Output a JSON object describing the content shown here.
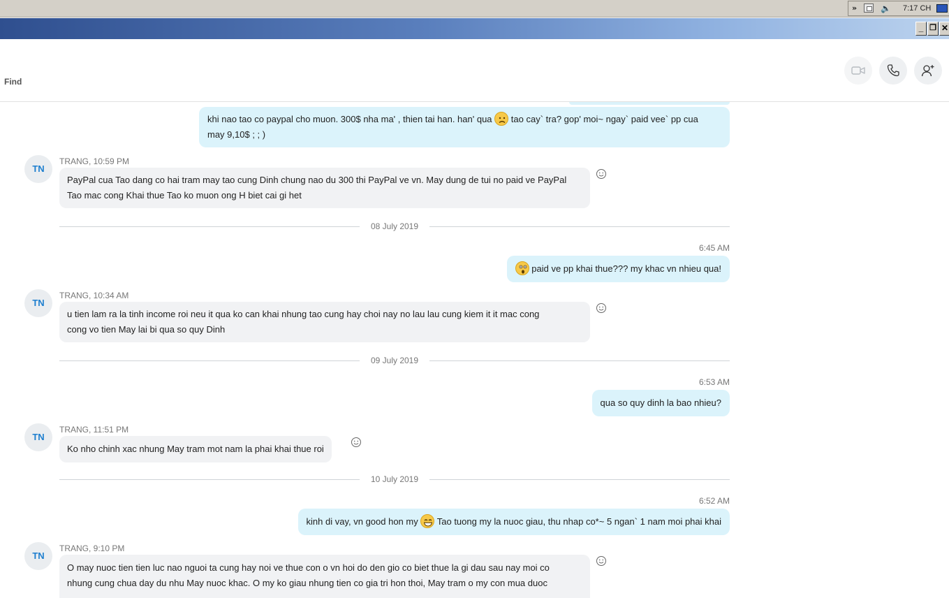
{
  "taskbar": {
    "chevron": "»",
    "clock": "7:17 CH"
  },
  "window": {
    "minimize": "_",
    "maximize": "❐",
    "close": "✕"
  },
  "header": {
    "find_label": "Find"
  },
  "separators": [
    "08 July 2019",
    "09 July 2019",
    "10 July 2019"
  ],
  "messages": {
    "m1": {
      "lines": [
        "khi nao tao co paypal cho muon. 300$ nha ma' , thien tai han. han' qua",
        "tao cay` tra? gop' moi~ ngay` paid vee` pp cua",
        "may 9,10$ ; ; )"
      ]
    },
    "m2": {
      "sender": "TRANG, 10:59 PM",
      "avatar": "TN",
      "lines": [
        "PayPal cua Tao dang co hai tram may tao cung Dinh chung nao du 300 thi PayPal ve vn. May dung de tui no paid ve PayPal",
        "Tao mac cong Khai thue Tao ko muon ong H biet cai gi het"
      ]
    },
    "m3": {
      "time": "6:45 AM",
      "text": "paid ve pp khai thue??? my khac vn nhieu qua!"
    },
    "m4": {
      "sender": "TRANG, 10:34 AM",
      "avatar": "TN",
      "lines": [
        "u tien lam ra la tinh income roi neu it qua ko can khai nhung tao cung hay choi nay no lau lau cung kiem it it mac cong",
        "cong vo tien May lai bi qua so quy Dinh"
      ]
    },
    "m5": {
      "time": "6:53 AM",
      "text": "qua so quy dinh la bao nhieu?"
    },
    "m6": {
      "sender": "TRANG, 11:51 PM",
      "avatar": "TN",
      "text": "Ko nho chinh xac nhung May tram mot nam la phai khai thue roi"
    },
    "m7": {
      "time": "6:52 AM",
      "text_a": "kinh di vay, vn good hon my",
      "text_b": "Tao tuong my la nuoc giau, thu nhap co*~ 5 ngan` 1 nam moi phai khai"
    },
    "m8": {
      "sender": "TRANG, 9:10 PM",
      "avatar": "TN",
      "lines": [
        "O may nuoc tien tien luc nao nguoi ta cung hay noi ve thue con o vn hoi do den gio co biet thue la gi dau sau nay moi co",
        "nhung cung chua day du nhu May nuoc khac. O my ko giau nhung tien co gia tri hon thoi, May tram o my con mua duoc"
      ]
    }
  },
  "icons": {
    "video": "video-camera-icon",
    "call": "phone-icon",
    "add": "add-person-icon",
    "react": "smiley-icon",
    "emoji_frown": "frown-emoji-icon",
    "emoji_shock": "shocked-emoji-icon",
    "emoji_grin": "grin-emoji-icon"
  },
  "colors": {
    "outgoing_bubble": "#dbf3fb",
    "incoming_bubble": "#f1f2f4",
    "avatar_text": "#1e7fcf"
  }
}
